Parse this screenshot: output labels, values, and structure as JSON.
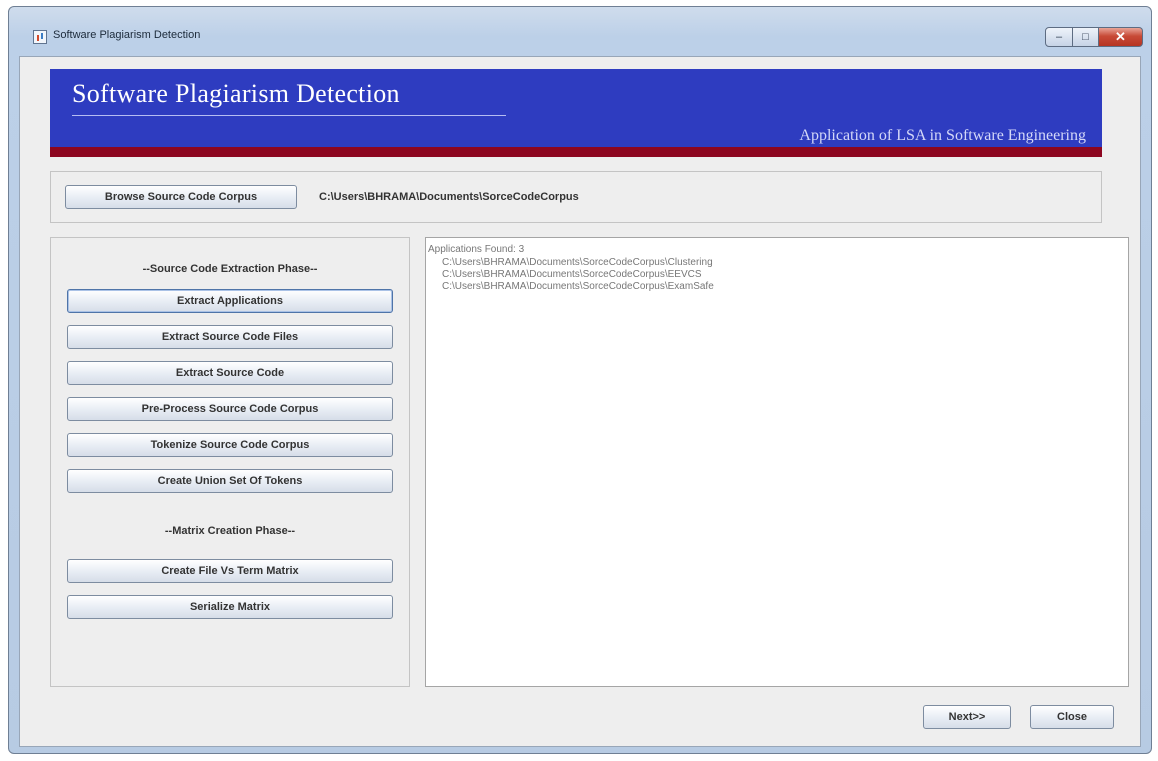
{
  "window": {
    "title": "Software Plagiarism Detection",
    "close_glyph": "✕",
    "min_glyph": "–",
    "max_glyph": "□"
  },
  "banner": {
    "title": "Software Plagiarism Detection",
    "subtitle": "Application of LSA in Software Engineering"
  },
  "browse": {
    "button_label": "Browse Source Code Corpus",
    "path": "C:\\Users\\BHRAMA\\Documents\\SorceCodeCorpus"
  },
  "extraction": {
    "phase_label": "--Source Code Extraction Phase--",
    "buttons": [
      "Extract Applications",
      "Extract Source Code Files",
      "Extract Source Code",
      "Pre-Process Source Code Corpus",
      "Tokenize Source Code Corpus",
      "Create Union Set Of Tokens"
    ]
  },
  "matrix": {
    "phase_label": "--Matrix Creation Phase--",
    "buttons": [
      "Create File Vs Term Matrix",
      "Serialize Matrix"
    ]
  },
  "output": {
    "header": "Applications Found: 3",
    "lines": [
      "C:\\Users\\BHRAMA\\Documents\\SorceCodeCorpus\\Clustering",
      "C:\\Users\\BHRAMA\\Documents\\SorceCodeCorpus\\EEVCS",
      "C:\\Users\\BHRAMA\\Documents\\SorceCodeCorpus\\ExamSafe"
    ]
  },
  "footer": {
    "next_label": "Next>>",
    "close_label": "Close"
  },
  "icons": {
    "window_icon": "app-icon"
  }
}
